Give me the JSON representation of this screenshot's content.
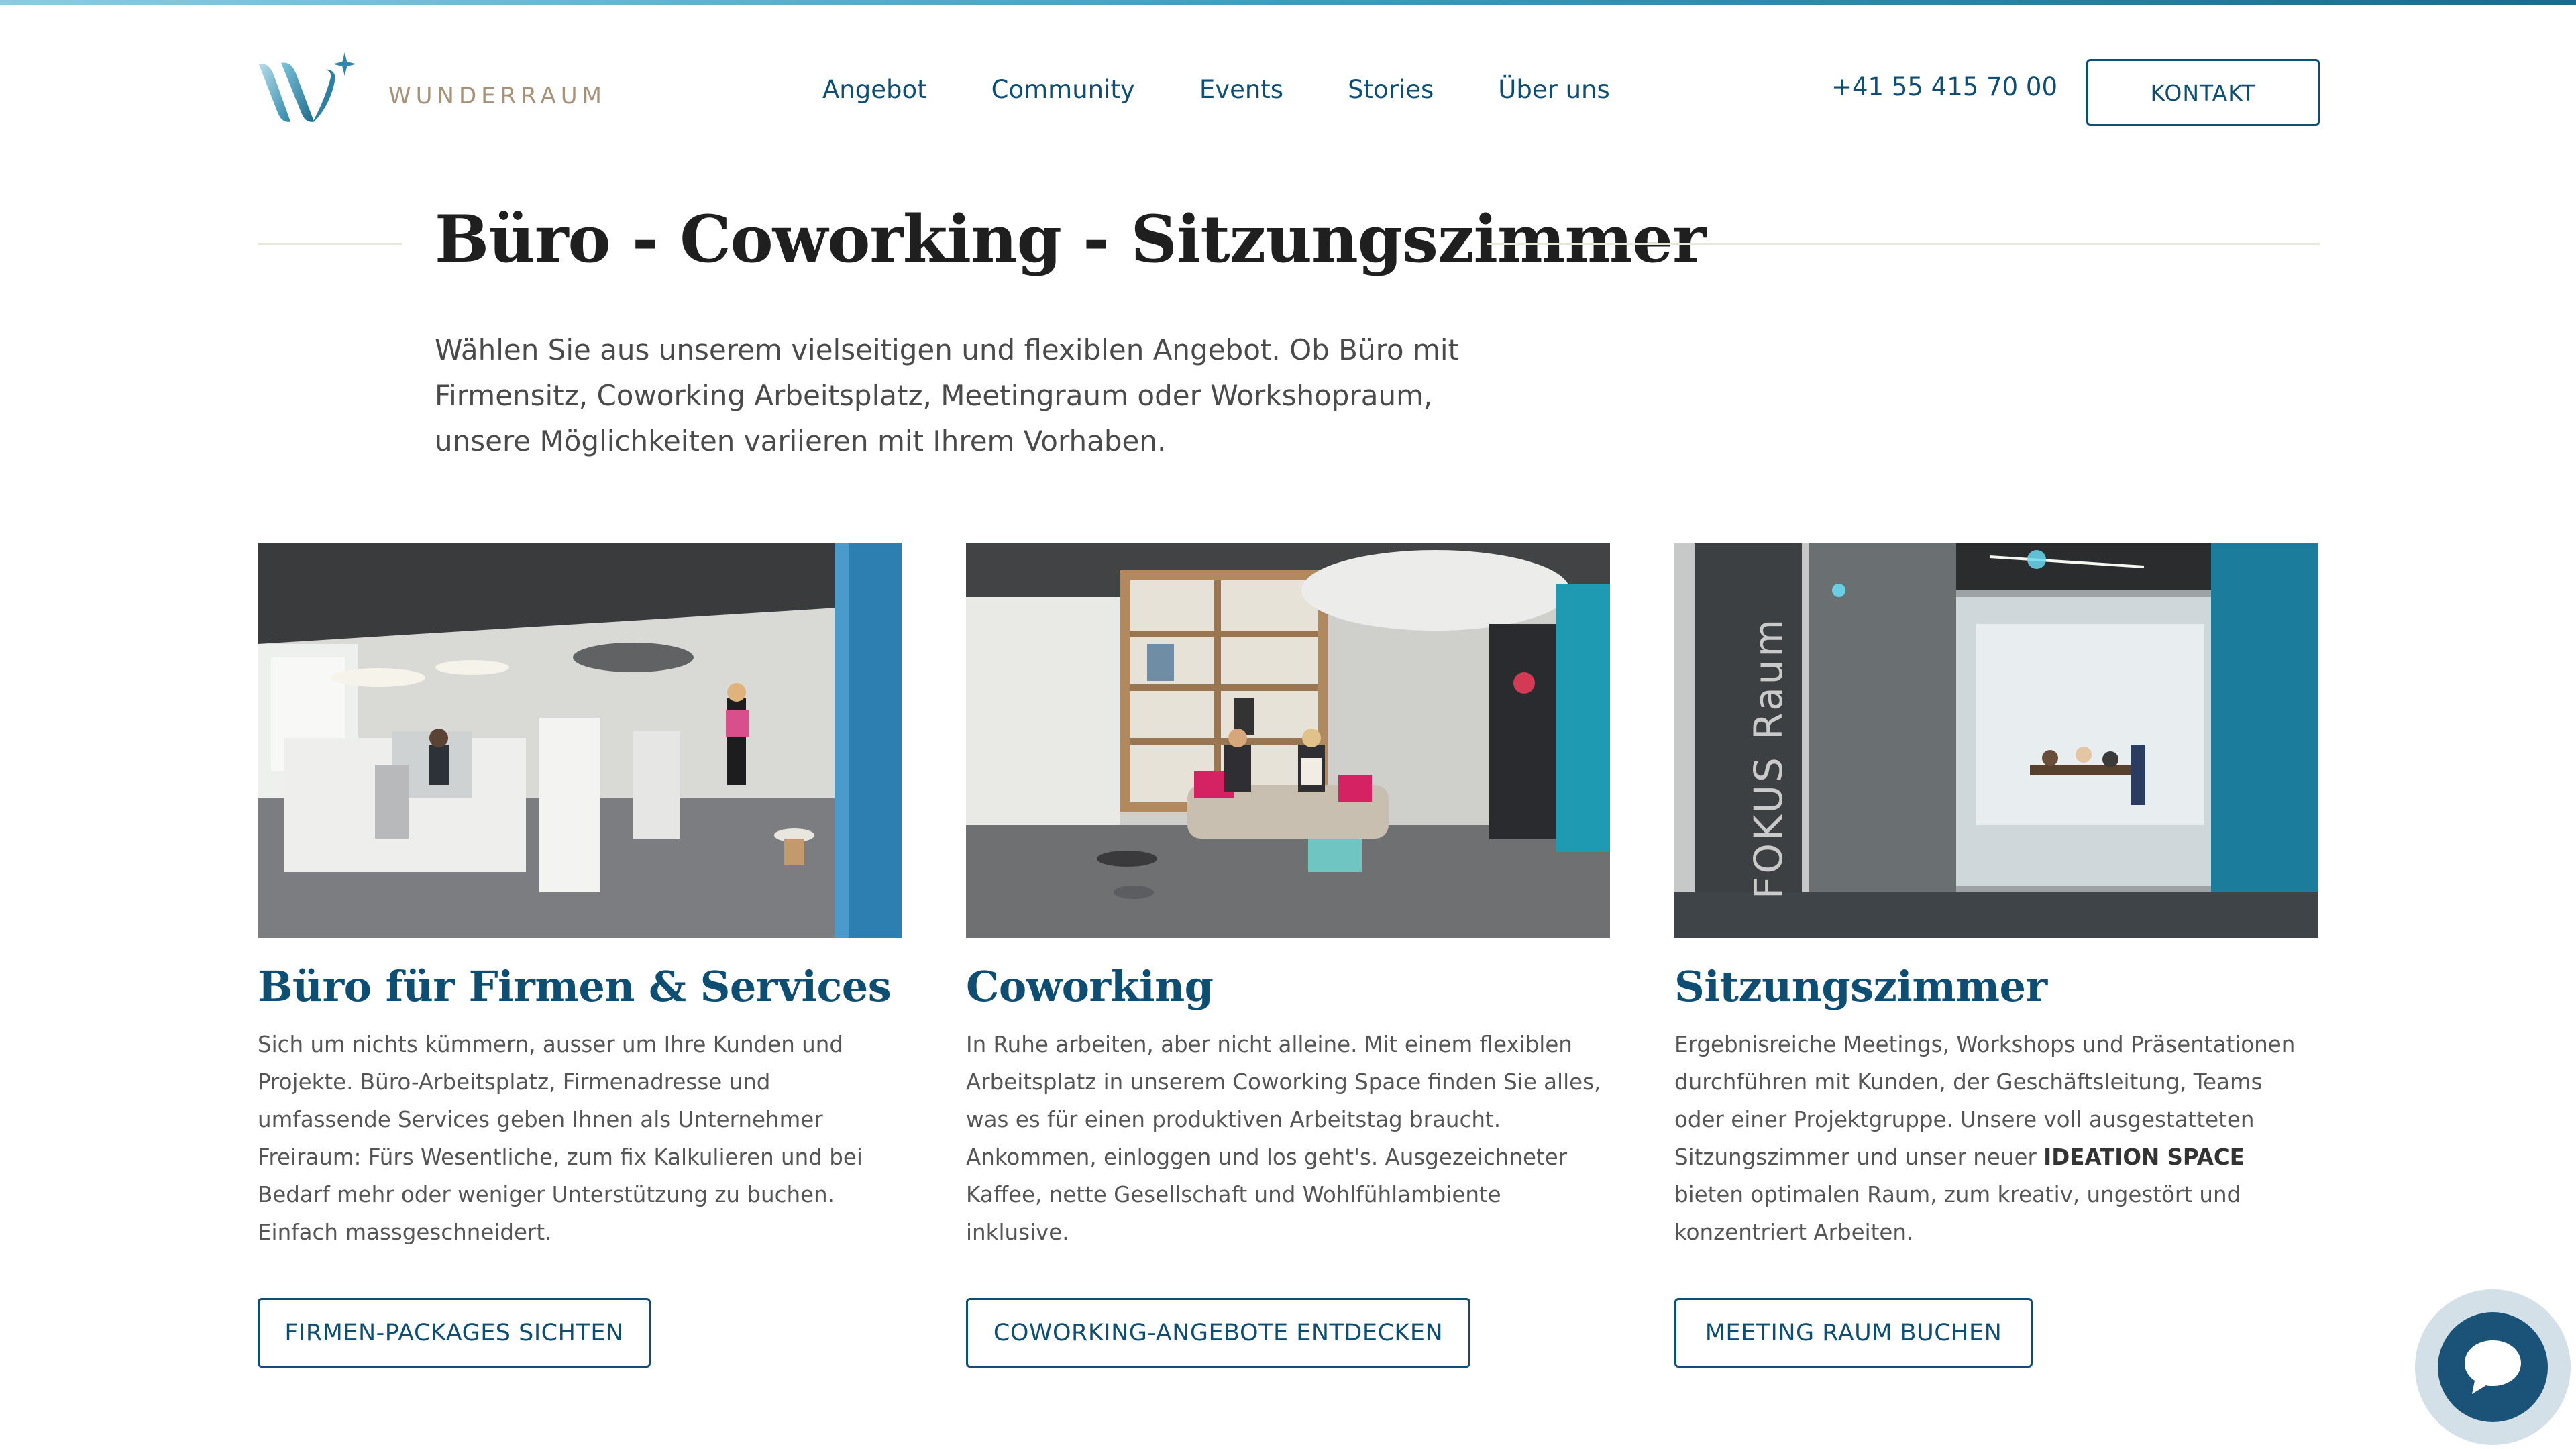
{
  "brand": {
    "name": "WUNDERRAUM",
    "colors": {
      "primary": "#0e4e73",
      "accent": "#3e9dbd",
      "logo_text": "#a69278",
      "rule": "#e9e6dc"
    }
  },
  "header": {
    "nav": [
      {
        "label": "Angebot"
      },
      {
        "label": "Community"
      },
      {
        "label": "Events"
      },
      {
        "label": "Stories"
      },
      {
        "label": "Über uns"
      }
    ],
    "phone": "+41 55 415 70 00",
    "contact_label": "KONTAKT"
  },
  "hero": {
    "title": "Büro - Coworking - Sitzungszimmer",
    "intro": "Wählen Sie aus unserem vielseitigen und flexiblen Angebot. Ob Büro mit Firmensitz, Coworking Arbeitsplatz, Meetingraum oder Workshopraum, unsere Möglichkeiten variieren mit Ihrem Vorhaben."
  },
  "cards": [
    {
      "title": "Büro für Firmen & Services",
      "text": "Sich um nichts kümmern, ausser um Ihre Kunden und Projekte. Büro-Arbeitsplatz, Firmenadresse und umfassende Services geben Ihnen als Unternehmer Freiraum: Fürs Wesentliche, zum fix Kalkulieren und bei Bedarf mehr oder weniger Unterstützung zu buchen. Einfach massgeschneidert.",
      "button": "FIRMEN-PACKAGES SICHTEN"
    },
    {
      "title": "Coworking",
      "text": "In Ruhe arbeiten, aber nicht alleine. Mit einem flexiblen Arbeitsplatz in unserem Coworking Space finden Sie alles, was es für einen produktiven Arbeitstag braucht. Ankommen, einloggen und los geht's. Ausgezeichneter Kaffee, nette Gesellschaft und Wohlfühlambiente inklusive.",
      "button": "COWORKING-ANGEBOTE ENTDECKEN"
    },
    {
      "title": "Sitzungszimmer",
      "text_before": "Ergebnisreiche Meetings, Workshops und Präsentationen durchführen mit Kunden, der Geschäftsleitung, Teams oder einer Projektgruppe. Unsere voll ausgestatteten Sitzungszimmer und unser neuer ",
      "text_bold": "IDEATION SPACE",
      "text_after": " bieten optimalen Raum, zum kreativ, ungestört und konzentriert Arbeiten.",
      "button": "MEETING RAUM BUCHEN",
      "image_sign": "FOKUS Raum"
    }
  ],
  "chat": {
    "icon": "chat-bubble-icon"
  }
}
